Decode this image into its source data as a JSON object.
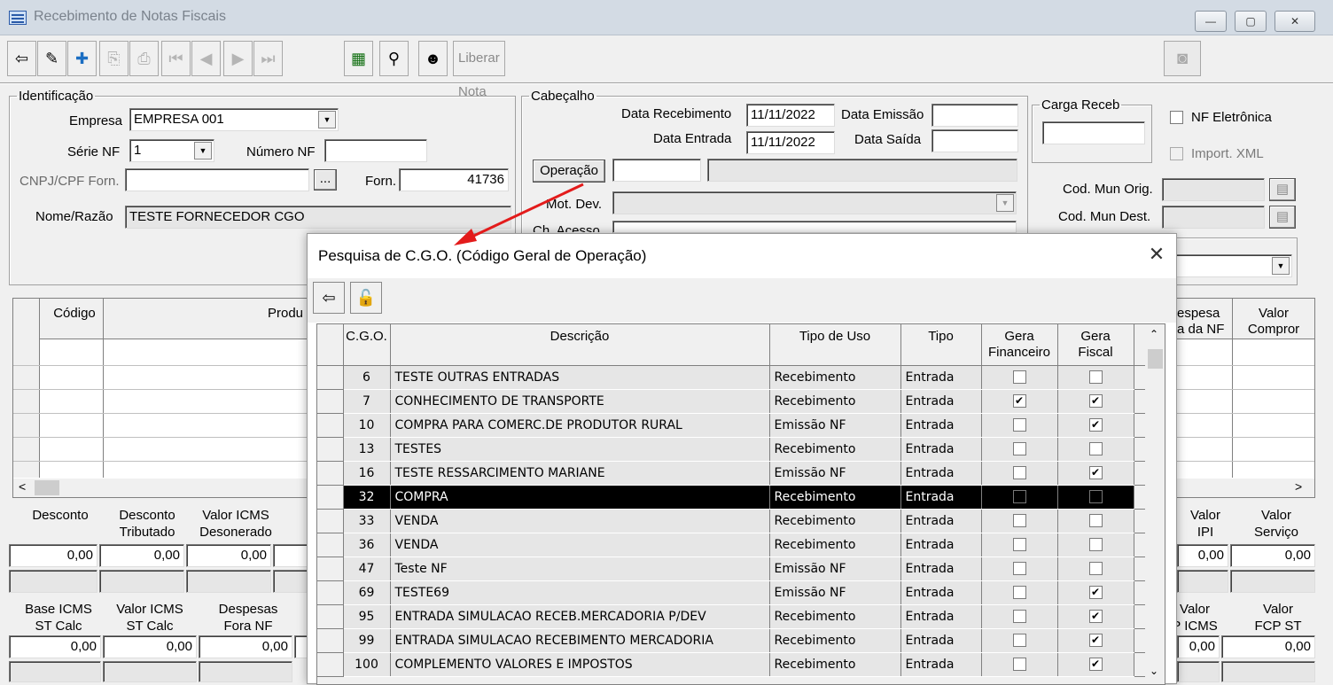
{
  "window": {
    "title": "Recebimento de Notas Fiscais",
    "btn_min": "—",
    "btn_max": "▢",
    "btn_close": "✕"
  },
  "toolbar": {
    "liberar_label": "Liberar Nota"
  },
  "identificacao": {
    "legend": "Identificação",
    "empresa_label": "Empresa",
    "empresa_value": "EMPRESA 001",
    "serie_label": "Série NF",
    "serie_value": "1",
    "numero_label": "Número NF",
    "numero_value": "",
    "cnpj_label": "CNPJ/CPF Forn.",
    "cnpj_value": "",
    "ellipsis": "...",
    "forn_label": "Forn.",
    "forn_value": "41736",
    "nome_label": "Nome/Razão",
    "nome_value": "TESTE FORNECEDOR CGO"
  },
  "cabecalho": {
    "legend": "Cabeçalho",
    "data_receb_label": "Data Recebimento",
    "data_receb_value": "11/11/2022",
    "data_emissao_label": "Data Emissão",
    "data_emissao_value": "",
    "data_entrada_label": "Data Entrada",
    "data_entrada_value": "11/11/2022",
    "data_saida_label": "Data Saída",
    "data_saida_value": "",
    "operacao_button": "Operação",
    "mot_dev_label": "Mot. Dev.",
    "ch_acesso_label": "Ch. Acesso"
  },
  "carga": {
    "legend": "Carga Receb",
    "value": ""
  },
  "right_panel": {
    "nf_eletronica": "NF Eletrônica",
    "import_xml": "Import. XML",
    "cod_mun_orig": "Cod. Mun Orig.",
    "cod_mun_dest": "Cod. Mun Dest."
  },
  "items_grid": {
    "col_codigo": "Código",
    "col_produto": "Produ",
    "col_despesa": "espesa\na da NF",
    "col_valor_compror": "Valor\nCompror"
  },
  "totals": {
    "desconto": "Desconto",
    "desconto_val": "0,00",
    "desconto_trib": "Desconto\nTributado",
    "desconto_trib_val": "0,00",
    "valor_icms_des": "Valor ICMS\nDesonerado",
    "valor_icms_des_val": "0,00",
    "valor_ipi": "Valor\nIPI",
    "valor_ipi_val": "0,00",
    "valor_servico": "Valor\nServiço",
    "valor_servico_val": "0,00",
    "base_icms_st": "Base ICMS\nST Calc",
    "base_icms_st_val": "0,00",
    "valor_icms_st": "Valor ICMS\nST Calc",
    "valor_icms_st_val": "0,00",
    "despesas_fora": "Despesas\nFora NF",
    "despesas_fora_val": "0,00",
    "valor_p_icms": "Valor\nP ICMS",
    "valor_p_icms_val": "0,00",
    "valor_fcp_st": "Valor\nFCP ST",
    "valor_fcp_st_val": "0,00"
  },
  "dialog": {
    "title": "Pesquisa de C.G.O. (Código Geral de Operação)",
    "close": "✕",
    "columns": {
      "cgo": "C.G.O.",
      "descricao": "Descrição",
      "tipo_uso": "Tipo de Uso",
      "tipo": "Tipo",
      "gera_fin": "Gera\nFinanceiro",
      "gera_fis": "Gera\nFiscal"
    },
    "rows": [
      {
        "cgo": "6",
        "descricao": "TESTE OUTRAS ENTRADAS",
        "tipo_uso": "Recebimento",
        "tipo": "Entrada",
        "fin": false,
        "fis": false
      },
      {
        "cgo": "7",
        "descricao": "CONHECIMENTO DE TRANSPORTE",
        "tipo_uso": "Recebimento",
        "tipo": "Entrada",
        "fin": true,
        "fis": true
      },
      {
        "cgo": "10",
        "descricao": "COMPRA PARA COMERC.DE PRODUTOR RURAL",
        "tipo_uso": "Emissão NF",
        "tipo": "Entrada",
        "fin": false,
        "fis": true
      },
      {
        "cgo": "13",
        "descricao": "TESTES",
        "tipo_uso": "Recebimento",
        "tipo": "Entrada",
        "fin": false,
        "fis": false
      },
      {
        "cgo": "16",
        "descricao": "TESTE RESSARCIMENTO MARIANE",
        "tipo_uso": "Emissão NF",
        "tipo": "Entrada",
        "fin": false,
        "fis": true
      },
      {
        "cgo": "32",
        "descricao": "COMPRA",
        "tipo_uso": "Recebimento",
        "tipo": "Entrada",
        "fin": false,
        "fis": false,
        "selected": true
      },
      {
        "cgo": "33",
        "descricao": "VENDA",
        "tipo_uso": "Recebimento",
        "tipo": "Entrada",
        "fin": false,
        "fis": false
      },
      {
        "cgo": "36",
        "descricao": "VENDA",
        "tipo_uso": "Recebimento",
        "tipo": "Entrada",
        "fin": false,
        "fis": false
      },
      {
        "cgo": "47",
        "descricao": "Teste NF",
        "tipo_uso": "Emissão NF",
        "tipo": "Entrada",
        "fin": false,
        "fis": false
      },
      {
        "cgo": "69",
        "descricao": "TESTE69",
        "tipo_uso": "Emissão NF",
        "tipo": "Entrada",
        "fin": false,
        "fis": true
      },
      {
        "cgo": "95",
        "descricao": "ENTRADA SIMULACAO RECEB.MERCADORIA P/DEV",
        "tipo_uso": "Recebimento",
        "tipo": "Entrada",
        "fin": false,
        "fis": true
      },
      {
        "cgo": "99",
        "descricao": "ENTRADA SIMULACAO RECEBIMENTO MERCADORIA",
        "tipo_uso": "Recebimento",
        "tipo": "Entrada",
        "fin": false,
        "fis": true
      },
      {
        "cgo": "100",
        "descricao": "COMPLEMENTO VALORES E IMPOSTOS",
        "tipo_uso": "Recebimento",
        "tipo": "Entrada",
        "fin": false,
        "fis": true
      }
    ]
  },
  "colors": {
    "selection": "#000000",
    "row_bg": "#e6e6e6",
    "arrow": "#e31b1b",
    "titlebar": "#d3dbe4"
  }
}
